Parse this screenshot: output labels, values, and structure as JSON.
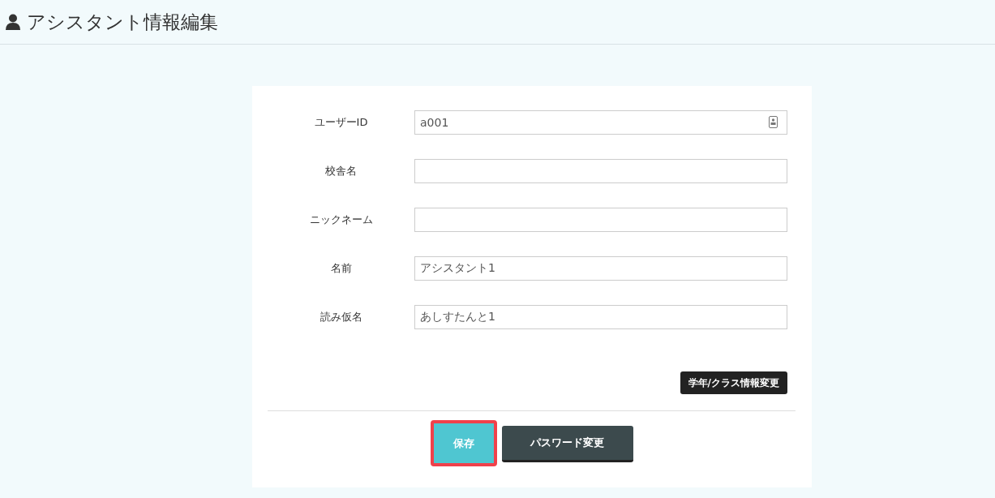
{
  "header": {
    "title": "アシスタント情報編集"
  },
  "fields": [
    {
      "label": "ユーザーID",
      "value": "a001",
      "kind": "contact"
    },
    {
      "label": "校舎名",
      "kind": "text"
    },
    {
      "label": "ニックネーム",
      "kind": "text"
    },
    {
      "label": "名前",
      "value": "アシスタント1",
      "kind": "text"
    },
    {
      "label": "読み仮名",
      "value": "あしすたんと1",
      "kind": "text"
    }
  ],
  "class_button": "学年/クラス情報変更",
  "actions": [
    {
      "label": "保存",
      "kind": "primary",
      "highlighted": true
    },
    {
      "label": "パスワード変更",
      "kind": "dark",
      "highlighted": false
    }
  ]
}
